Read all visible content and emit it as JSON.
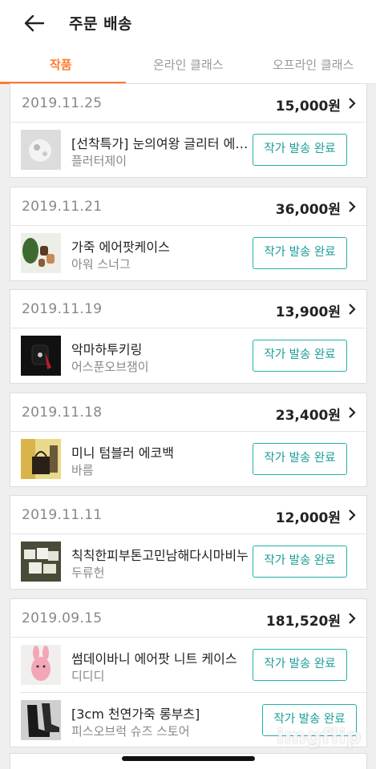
{
  "header": {
    "title": "주문 배송",
    "back_icon": "back-arrow-icon"
  },
  "tabs": [
    {
      "label": "작품",
      "active": true
    },
    {
      "label": "온라인 클래스",
      "active": false
    },
    {
      "label": "오프라인 클래스",
      "active": false
    }
  ],
  "colors": {
    "accent": "#ff7a2f",
    "button": "#22b0a8"
  },
  "orders": [
    {
      "date": "2019.11.25",
      "amount": "15,000원",
      "items": [
        {
          "name": "[선착특가] 눈의여왕 글리터 에어팟 케이스",
          "seller": "플러터제이",
          "status": "작가 발송 완료"
        }
      ]
    },
    {
      "date": "2019.11.21",
      "amount": "36,000원",
      "items": [
        {
          "name": "가죽 에어팟케이스",
          "seller": "아워 스너그",
          "status": "작가 발송 완료"
        }
      ]
    },
    {
      "date": "2019.11.19",
      "amount": "13,900원",
      "items": [
        {
          "name": "악마하투키링",
          "seller": "어스푼오브잼이",
          "status": "작가 발송 완료"
        }
      ]
    },
    {
      "date": "2019.11.18",
      "amount": "23,400원",
      "items": [
        {
          "name": "미니 텀블러 에코백",
          "seller": "바름",
          "status": "작가 발송 완료"
        }
      ]
    },
    {
      "date": "2019.11.11",
      "amount": "12,000원",
      "items": [
        {
          "name": "칙칙한피부톤고민남해다시마비누",
          "seller": "두류헌",
          "status": "작가 발송 완료"
        }
      ]
    },
    {
      "date": "2019.09.15",
      "amount": "181,520원",
      "items": [
        {
          "name": "썸데이바니 에어팟 니트 케이스",
          "seller": "디디디",
          "status": "작가 발송 완료"
        },
        {
          "name": "[3cm 천연가죽 롱부츠]",
          "seller": "피스오브럭 슈즈 스토어",
          "status": "작가 발송 완료"
        }
      ]
    }
  ],
  "watermark": "imgflip"
}
